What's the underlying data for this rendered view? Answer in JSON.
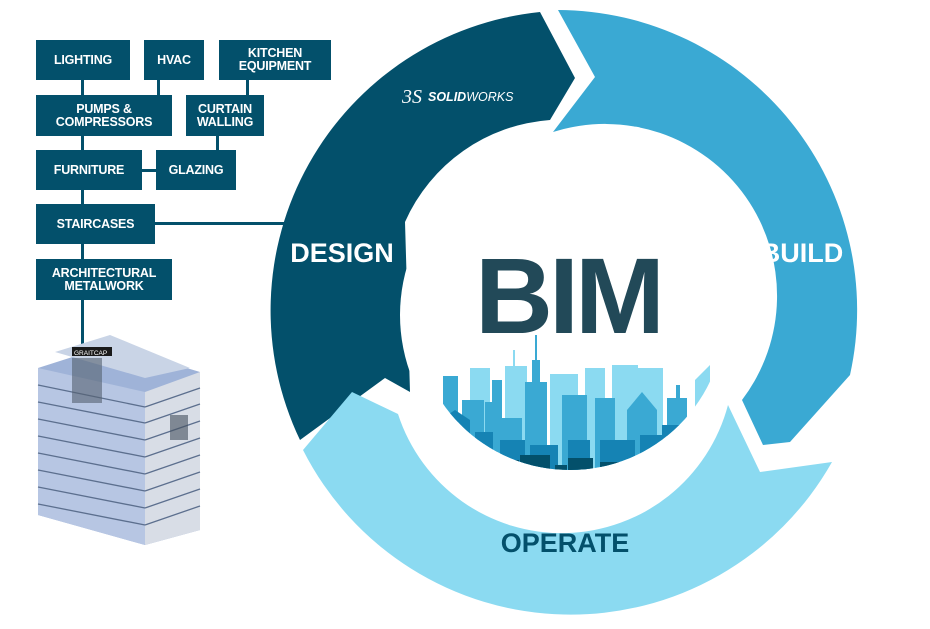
{
  "title": "BIM",
  "phases": [
    {
      "label": "DESIGN",
      "color": "#03506b"
    },
    {
      "label": "BUILD",
      "color": "#3aa9d3"
    },
    {
      "label": "OPERATE",
      "color": "#8bdaf1"
    }
  ],
  "brand": {
    "logo_text_bold": "SOLID",
    "logo_text_light": "WORKS",
    "logo_mark": "3S"
  },
  "components": [
    {
      "label": "LIGHTING"
    },
    {
      "label": "HVAC"
    },
    {
      "label": "KITCHEN EQUIPMENT"
    },
    {
      "label": "PUMPS & COMPRESSORS"
    },
    {
      "label": "CURTAIN WALLING"
    },
    {
      "label": "FURNITURE"
    },
    {
      "label": "GLAZING"
    },
    {
      "label": "STAIRCASES"
    },
    {
      "label": "ARCHITECTURAL METALWORK"
    }
  ],
  "building": {
    "sign_text": "GRAITCAP"
  },
  "colors": {
    "box": "#03506b",
    "title": "#224958",
    "skyline_light": "#8bdaf1",
    "skyline_mid": "#3aa9d3",
    "skyline_dark": "#1583b4",
    "skyline_darkest": "#03506b"
  }
}
